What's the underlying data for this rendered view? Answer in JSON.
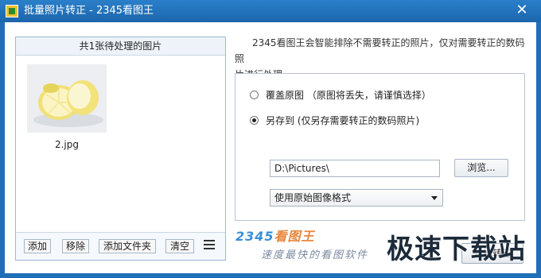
{
  "window": {
    "title": "批量照片转正 - 2345看图王",
    "close_label": "✕"
  },
  "left_panel": {
    "header": "共1张待处理的图片",
    "images": [
      {
        "name": "2.jpg",
        "icon": "lemon-image"
      }
    ],
    "toolbar": {
      "add": "添加",
      "remove": "移除",
      "add_folder": "添加文件夹",
      "clear": "清空",
      "view_icon": "list-view-icon"
    }
  },
  "description": {
    "line1": "2345看图王会智能排除不需要转正的照片，仅对需要转正的数码照",
    "line2": "片进行处理。"
  },
  "options": {
    "overwrite_label": "覆盖原图 （原图将丢失，请谨慎选择）",
    "save_as_label": "另存到 (仅另存需要转正的数码照片)",
    "selected": "save_as",
    "path_value": "D:\\Pictures\\",
    "browse_label": "浏览...",
    "format_value": "使用原始图像格式"
  },
  "footer": {
    "logo_number": "2345",
    "logo_text": "看图王",
    "slogan": "速度最快的看图软件",
    "ok_label": "开始转正",
    "site_watermark": "极速下载站"
  },
  "colors": {
    "titlebar": "#1f6fb8",
    "accent_orange": "#e8863a",
    "accent_blue": "#3a8fd8"
  }
}
